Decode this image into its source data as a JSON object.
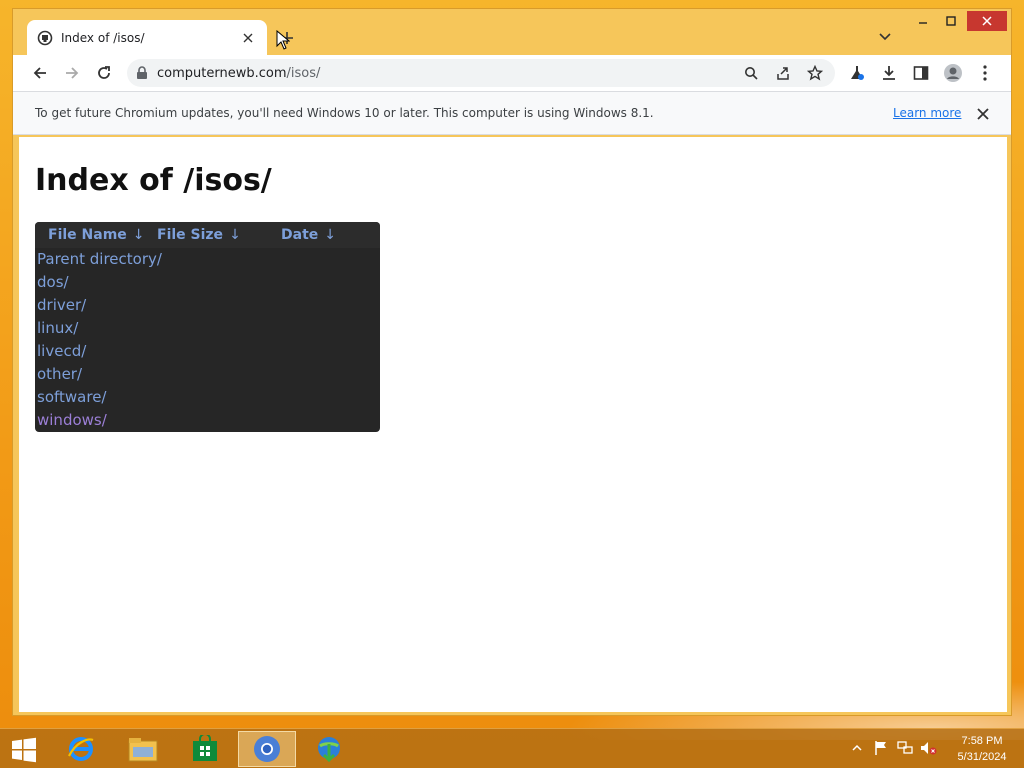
{
  "browser": {
    "tab": {
      "title": "Index of /isos/"
    },
    "address": {
      "host": "computernewb.com",
      "path": "/isos/"
    },
    "infobar": {
      "message": "To get future Chromium updates, you'll need Windows 10 or later. This computer is using Windows 8.1.",
      "link": "Learn more"
    }
  },
  "page": {
    "title": "Index of /isos/",
    "columns": [
      {
        "label": "File Name",
        "sort": "↓"
      },
      {
        "label": "File Size",
        "sort": "↓"
      },
      {
        "label": "Date",
        "sort": "↓"
      }
    ],
    "entries": [
      {
        "name": "Parent directory/",
        "visited": false
      },
      {
        "name": "dos/",
        "visited": false
      },
      {
        "name": "driver/",
        "visited": false
      },
      {
        "name": "linux/",
        "visited": false
      },
      {
        "name": "livecd/",
        "visited": false
      },
      {
        "name": "other/",
        "visited": false
      },
      {
        "name": "software/",
        "visited": false
      },
      {
        "name": "windows/",
        "visited": true
      }
    ]
  },
  "taskbar": {
    "time": "7:58 PM",
    "date": "5/31/2024"
  },
  "colors": {
    "accent": "#f6c65a",
    "link": "#7d9fd9",
    "visited": "#9b7fd6",
    "close": "#c7372f"
  }
}
